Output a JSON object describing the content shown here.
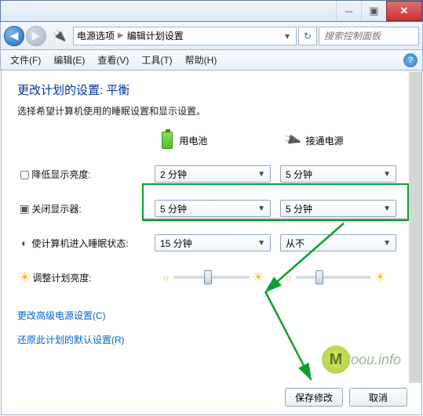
{
  "titlebar": {
    "min": "─",
    "max": "▣",
    "close": "✕"
  },
  "nav": {
    "back": "◀",
    "fwd": "▶",
    "crumb1": "电源选项",
    "crumb2": "编辑计划设置",
    "refresh": "↻",
    "search_placeholder": "搜索控制面板"
  },
  "menu": {
    "file": "文件(F)",
    "edit": "编辑(E)",
    "view": "查看(V)",
    "tools": "工具(T)",
    "help": "帮助(H)",
    "q": "?"
  },
  "page": {
    "title": "更改计划的设置: 平衡",
    "subtitle": "选择希望计算机使用的睡眠设置和显示设置。",
    "col_battery": "用电池",
    "col_plugged": "接通电源"
  },
  "rows": {
    "dim": {
      "label": "降低显示亮度:",
      "battery": "2 分钟",
      "plugged": "5 分钟"
    },
    "off": {
      "label": "关闭显示器:",
      "battery": "5 分钟",
      "plugged": "5 分钟"
    },
    "sleep": {
      "label": "使计算机进入睡眠状态:",
      "battery": "15 分钟",
      "plugged": "从不"
    },
    "bright": {
      "label": "调整计划亮度:"
    }
  },
  "links": {
    "advanced": "更改高级电源设置(C)",
    "restore": "还原此计划的默认设置(R)"
  },
  "buttons": {
    "save": "保存修改",
    "cancel": "取消"
  },
  "watermark": {
    "m": "M",
    "rest": "toou.info"
  }
}
